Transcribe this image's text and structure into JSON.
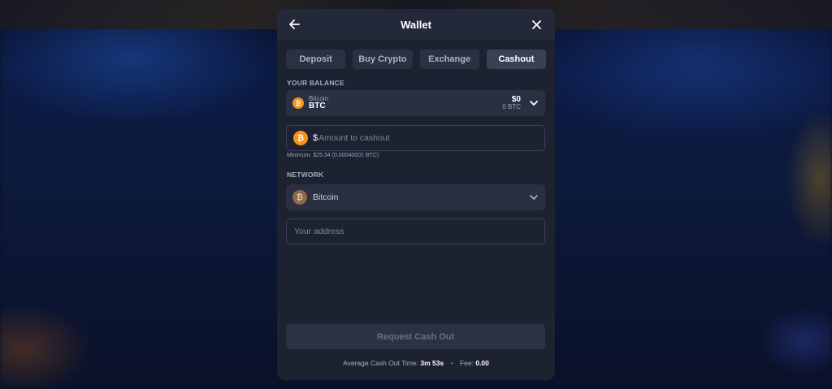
{
  "modal": {
    "title": "Wallet"
  },
  "tabs": [
    {
      "label": "Deposit",
      "active": false
    },
    {
      "label": "Buy Crypto",
      "active": false
    },
    {
      "label": "Exchange",
      "active": false
    },
    {
      "label": "Cashout",
      "active": true
    }
  ],
  "balance": {
    "section_label": "YOUR BALANCE",
    "coin_name": "Bitcoin",
    "coin_symbol": "BTC",
    "usd_value": "$0",
    "crypto_value": "0 BTC",
    "coin_glyph": "₿"
  },
  "amount": {
    "currency_symbol": "$",
    "placeholder": "Amount to cashout",
    "value": "",
    "minimum_note": "Minimum: $25.34 (0.00040001 BTC)"
  },
  "network": {
    "section_label": "NETWORK",
    "selected": "Bitcoin"
  },
  "address": {
    "placeholder": "Your address",
    "value": ""
  },
  "submit": {
    "label": "Request Cash Out"
  },
  "footer": {
    "avg_label": "Average Cash Out Time:",
    "avg_value": "3m 53s",
    "fee_label": "Fee:",
    "fee_value": "0.00"
  },
  "icons": {
    "back": "arrow-left-icon",
    "close": "close-icon",
    "dropdown": "chevron-down-icon",
    "coin": "bitcoin-icon"
  },
  "colors": {
    "modal_bg": "#1d2231",
    "header_bg": "#232939",
    "field_bg": "#2a3041",
    "active_tab": "#3a4154",
    "bitcoin_orange": "#f7931a"
  }
}
